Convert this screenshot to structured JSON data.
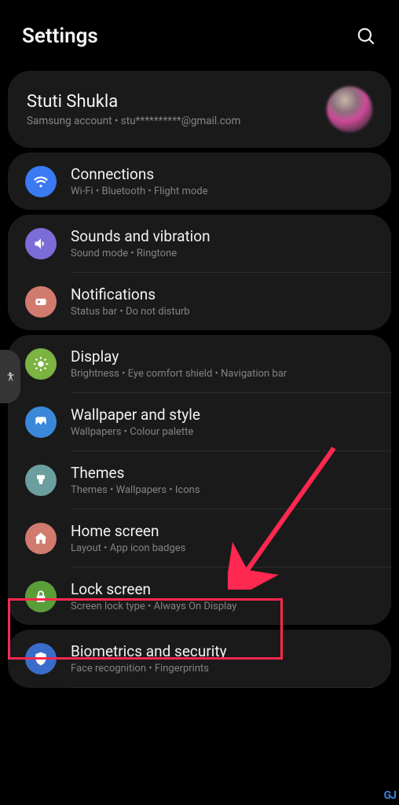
{
  "header": {
    "title": "Settings"
  },
  "account": {
    "name": "Stuti Shukla",
    "subtitle": "Samsung account  •  stu**********@gmail.com"
  },
  "connections": {
    "title": "Connections",
    "subtitle": "Wi-Fi  •  Bluetooth  •  Flight mode"
  },
  "sounds": {
    "title": "Sounds and vibration",
    "subtitle": "Sound mode  •  Ringtone"
  },
  "notifications": {
    "title": "Notifications",
    "subtitle": "Status bar  •  Do not disturb"
  },
  "display": {
    "title": "Display",
    "subtitle": "Brightness  •  Eye comfort shield  •  Navigation bar"
  },
  "wallpaper": {
    "title": "Wallpaper and style",
    "subtitle": "Wallpapers  •  Colour palette"
  },
  "themes": {
    "title": "Themes",
    "subtitle": "Themes  •  Wallpapers  •  Icons"
  },
  "home": {
    "title": "Home screen",
    "subtitle": "Layout  •  App icon badges"
  },
  "lock": {
    "title": "Lock screen",
    "subtitle": "Screen lock type  •  Always On Display"
  },
  "biometrics": {
    "title": "Biometrics and security",
    "subtitle": "Face recognition  •  Fingerprints"
  },
  "watermark": "GJ"
}
